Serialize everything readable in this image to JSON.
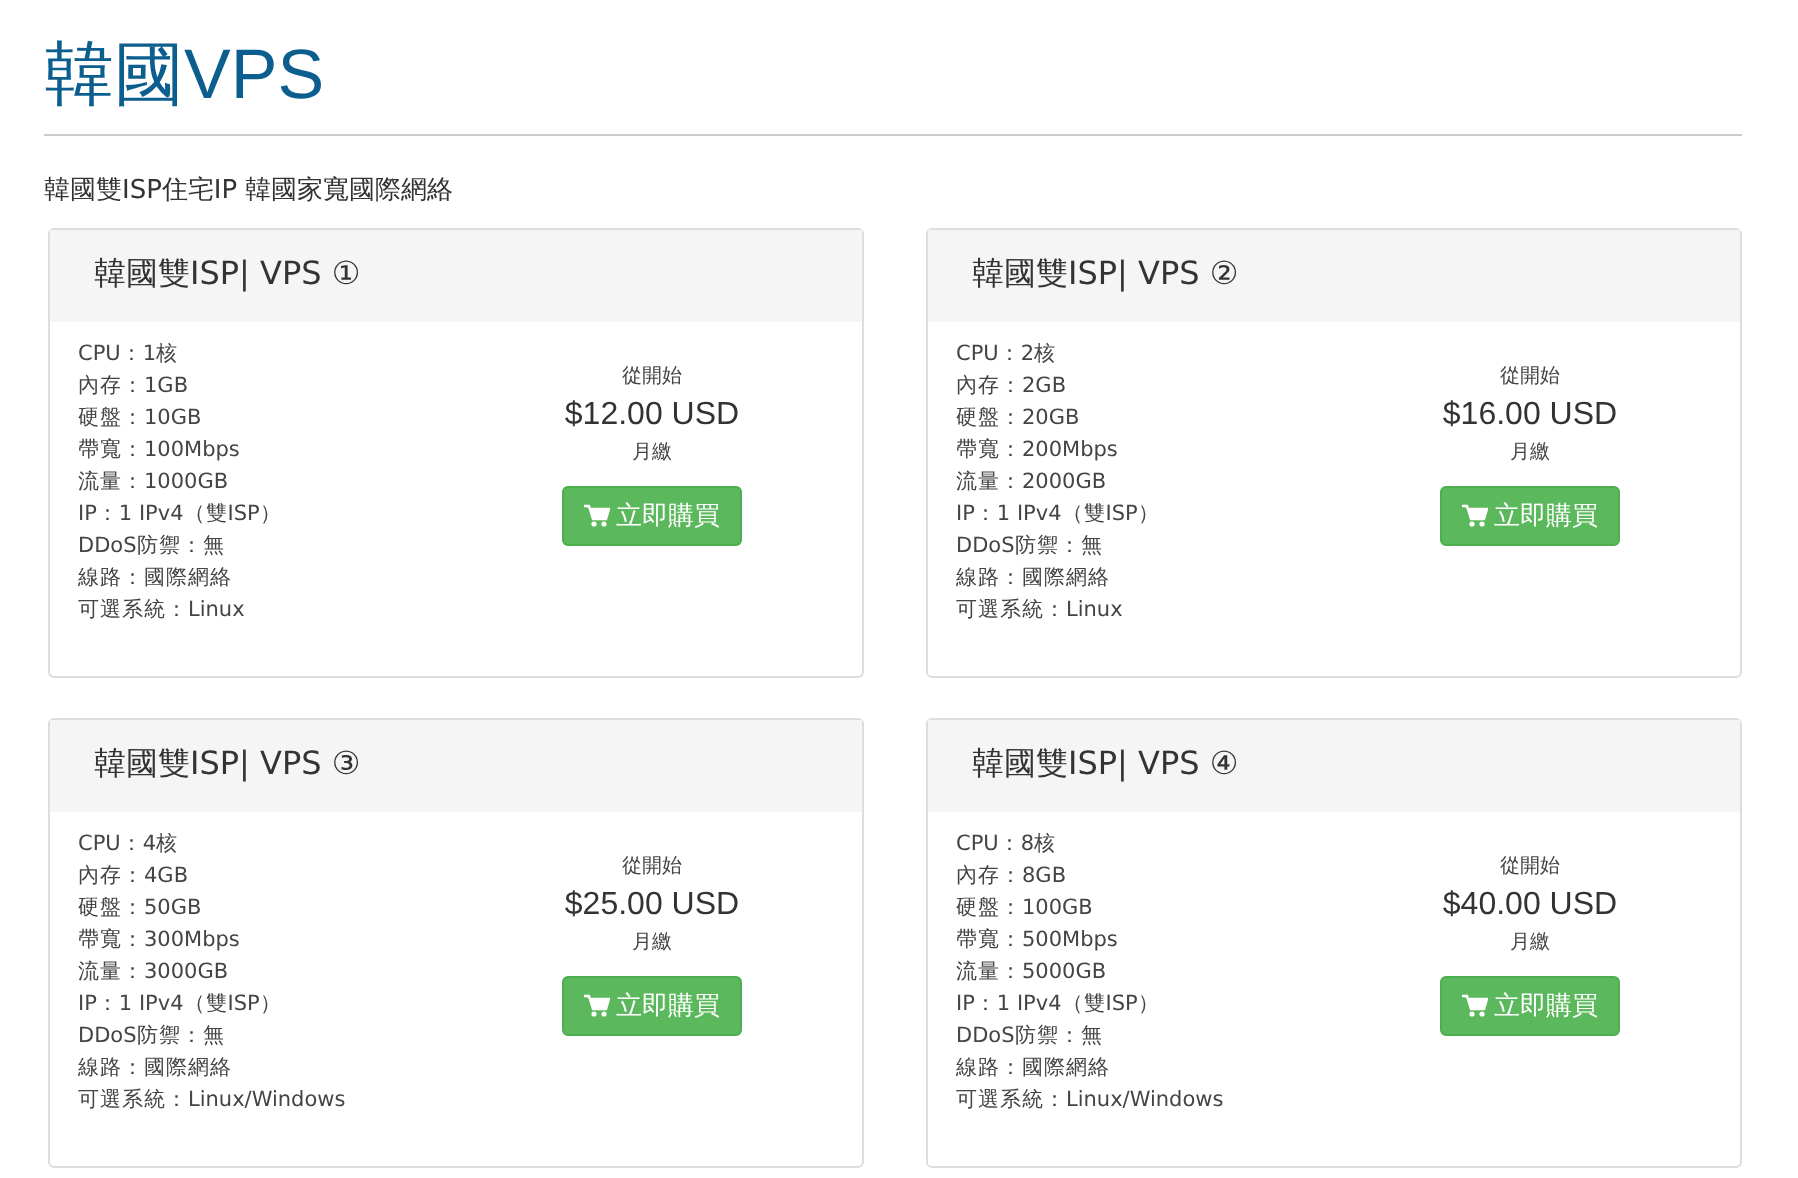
{
  "page": {
    "title": "韓國VPS",
    "subtitle": "韓國雙ISP住宅IP 韓國家寬國際網絡"
  },
  "products": [
    {
      "name": "韓國雙ISP| VPS ①",
      "features": [
        "CPU：1核",
        "內存：1GB",
        "硬盤：10GB",
        "帶寬：100Mbps",
        "流量：1000GB",
        "IP：1 IPv4（雙ISP）",
        "DDoS防禦：無",
        "線路：國際網絡",
        "可選系統：Linux"
      ],
      "from": "從開始",
      "price": "$12.00 USD",
      "cycle": "月繳",
      "button": "立即購買"
    },
    {
      "name": "韓國雙ISP| VPS ②",
      "features": [
        "CPU：2核",
        "內存：2GB",
        "硬盤：20GB",
        "帶寬：200Mbps",
        "流量：2000GB",
        "IP：1 IPv4（雙ISP）",
        "DDoS防禦：無",
        "線路：國際網絡",
        "可選系統：Linux"
      ],
      "from": "從開始",
      "price": "$16.00 USD",
      "cycle": "月繳",
      "button": "立即購買"
    },
    {
      "name": "韓國雙ISP| VPS ③",
      "features": [
        "CPU：4核",
        "內存：4GB",
        "硬盤：50GB",
        "帶寬：300Mbps",
        "流量：3000GB",
        "IP：1 IPv4（雙ISP）",
        "DDoS防禦：無",
        "線路：國際網絡",
        "可選系統：Linux/Windows"
      ],
      "from": "從開始",
      "price": "$25.00 USD",
      "cycle": "月繳",
      "button": "立即購買"
    },
    {
      "name": "韓國雙ISP| VPS ④",
      "features": [
        "CPU：8核",
        "內存：8GB",
        "硬盤：100GB",
        "帶寬：500Mbps",
        "流量：5000GB",
        "IP：1 IPv4（雙ISP）",
        "DDoS防禦：無",
        "線路：國際網絡",
        "可選系統：Linux/Windows"
      ],
      "from": "從開始",
      "price": "$40.00 USD",
      "cycle": "月繳",
      "button": "立即購買"
    }
  ]
}
